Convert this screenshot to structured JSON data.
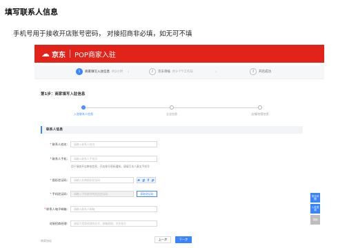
{
  "heading": "填写联系人信息",
  "note": "手机号用于接收开店账号密码， 对接招商非必填，如无可不填",
  "topbar": {
    "brand": "京东",
    "portal": "POP商家入驻"
  },
  "steps": [
    {
      "num": "1",
      "label": "商家填写入驻信息",
      "sub": "约2小时"
    },
    {
      "num": "2",
      "label": "京东审核",
      "sub": "约3-7个工作日"
    },
    {
      "num": "3",
      "label": "开店成功",
      "sub": ""
    }
  ],
  "stage_title": "第1步：商家填写入驻信息",
  "progress": [
    {
      "label": "入驻联系人信息"
    },
    {
      "label": "企业信息"
    },
    {
      "label": "店铺/经营信息"
    }
  ],
  "section_title": "联系人信息",
  "form": {
    "name": {
      "label": "联系人姓名:",
      "placeholder": "请输入联系人姓名"
    },
    "phone": {
      "label": "联系人手机:",
      "placeholder": "请输入联系人手机号",
      "hint": "用于接收开店审核信息、开店账号密码通知，请填写本人真实手机号"
    },
    "captcha": {
      "label": "图形验证码:",
      "placeholder": "请输入右侧图形验证码",
      "code": "a g t p"
    },
    "sms": {
      "label": "手机验证码:",
      "placeholder": "请输入手机收到的短信验证码",
      "button": "获取验证码"
    },
    "email": {
      "label": "联系人电子邮箱:",
      "placeholder": "请输入联系人邮箱"
    },
    "merchant": {
      "label": "对接招商经理:",
      "placeholder": "请填写招商经理的名字、邮箱前缀、京东账号"
    }
  },
  "float_buttons": [
    {
      "label": "常见问题"
    },
    {
      "label": "入驻咨询"
    },
    {
      "label": "顶部"
    }
  ],
  "footer": {
    "left": "商家协议",
    "prev": "上一步",
    "next": "下一步"
  }
}
